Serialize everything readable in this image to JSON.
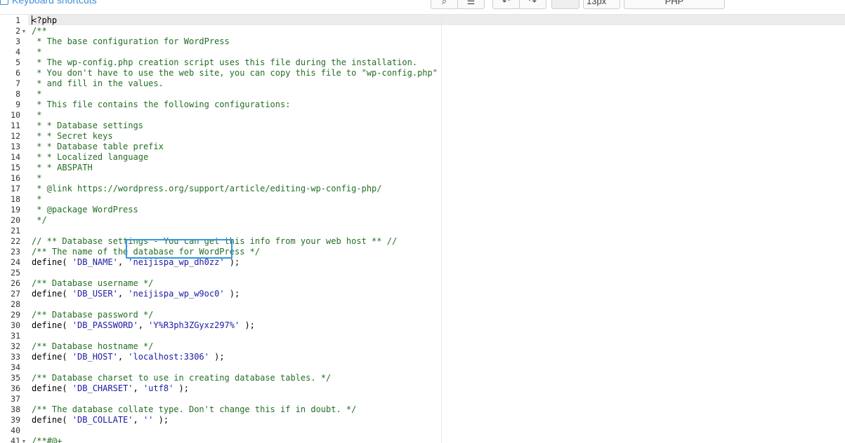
{
  "toolbar": {
    "keyboard_shortcuts_label": "Keyboard shortcuts",
    "font_size_value": "13px",
    "mode_value": "PHP"
  },
  "editor": {
    "lines": [
      {
        "n": "1",
        "fold": "",
        "tokens": [
          {
            "c": "tag",
            "t": "<?php"
          }
        ]
      },
      {
        "n": "2",
        "fold": "▾",
        "tokens": [
          {
            "c": "comment",
            "t": "/**"
          }
        ]
      },
      {
        "n": "3",
        "fold": "",
        "tokens": [
          {
            "c": "comment",
            "t": " * The base configuration for WordPress"
          }
        ]
      },
      {
        "n": "4",
        "fold": "",
        "tokens": [
          {
            "c": "comment",
            "t": " *"
          }
        ]
      },
      {
        "n": "5",
        "fold": "",
        "tokens": [
          {
            "c": "comment",
            "t": " * The wp-config.php creation script uses this file during the installation."
          }
        ]
      },
      {
        "n": "6",
        "fold": "",
        "tokens": [
          {
            "c": "comment",
            "t": " * You don't have to use the web site, you can copy this file to \"wp-config.php\""
          }
        ]
      },
      {
        "n": "7",
        "fold": "",
        "tokens": [
          {
            "c": "comment",
            "t": " * and fill in the values."
          }
        ]
      },
      {
        "n": "8",
        "fold": "",
        "tokens": [
          {
            "c": "comment",
            "t": " *"
          }
        ]
      },
      {
        "n": "9",
        "fold": "",
        "tokens": [
          {
            "c": "comment",
            "t": " * This file contains the following configurations:"
          }
        ]
      },
      {
        "n": "10",
        "fold": "",
        "tokens": [
          {
            "c": "comment",
            "t": " *"
          }
        ]
      },
      {
        "n": "11",
        "fold": "",
        "tokens": [
          {
            "c": "comment",
            "t": " * * Database settings"
          }
        ]
      },
      {
        "n": "12",
        "fold": "",
        "tokens": [
          {
            "c": "comment",
            "t": " * * Secret keys"
          }
        ]
      },
      {
        "n": "13",
        "fold": "",
        "tokens": [
          {
            "c": "comment",
            "t": " * * Database table prefix"
          }
        ]
      },
      {
        "n": "14",
        "fold": "",
        "tokens": [
          {
            "c": "comment",
            "t": " * * Localized language"
          }
        ]
      },
      {
        "n": "15",
        "fold": "",
        "tokens": [
          {
            "c": "comment",
            "t": " * * ABSPATH"
          }
        ]
      },
      {
        "n": "16",
        "fold": "",
        "tokens": [
          {
            "c": "comment",
            "t": " *"
          }
        ]
      },
      {
        "n": "17",
        "fold": "",
        "tokens": [
          {
            "c": "comment",
            "t": " * @link https://wordpress.org/support/article/editing-wp-config-php/"
          }
        ]
      },
      {
        "n": "18",
        "fold": "",
        "tokens": [
          {
            "c": "comment",
            "t": " *"
          }
        ]
      },
      {
        "n": "19",
        "fold": "",
        "tokens": [
          {
            "c": "comment",
            "t": " * @package WordPress"
          }
        ]
      },
      {
        "n": "20",
        "fold": "",
        "tokens": [
          {
            "c": "comment",
            "t": " */"
          }
        ]
      },
      {
        "n": "21",
        "fold": "",
        "tokens": []
      },
      {
        "n": "22",
        "fold": "",
        "tokens": [
          {
            "c": "comment",
            "t": "// ** Database settings - You can get this info from your web host ** //"
          }
        ]
      },
      {
        "n": "23",
        "fold": "",
        "tokens": [
          {
            "c": "comment",
            "t": "/** The name of the database for WordPress */"
          }
        ]
      },
      {
        "n": "24",
        "fold": "",
        "tokens": [
          {
            "c": "plain",
            "t": "define( "
          },
          {
            "c": "string",
            "t": "'DB_NAME'"
          },
          {
            "c": "plain",
            "t": ", "
          },
          {
            "c": "string",
            "t": "'neijispa_wp_dh0zz'"
          },
          {
            "c": "plain",
            "t": " );"
          }
        ]
      },
      {
        "n": "25",
        "fold": "",
        "tokens": []
      },
      {
        "n": "26",
        "fold": "",
        "tokens": [
          {
            "c": "comment",
            "t": "/** Database username */"
          }
        ]
      },
      {
        "n": "27",
        "fold": "",
        "tokens": [
          {
            "c": "plain",
            "t": "define( "
          },
          {
            "c": "string",
            "t": "'DB_USER'"
          },
          {
            "c": "plain",
            "t": ", "
          },
          {
            "c": "string",
            "t": "'neijispa_wp_w9oc0'"
          },
          {
            "c": "plain",
            "t": " );"
          }
        ]
      },
      {
        "n": "28",
        "fold": "",
        "tokens": []
      },
      {
        "n": "29",
        "fold": "",
        "tokens": [
          {
            "c": "comment",
            "t": "/** Database password */"
          }
        ]
      },
      {
        "n": "30",
        "fold": "",
        "tokens": [
          {
            "c": "plain",
            "t": "define( "
          },
          {
            "c": "string",
            "t": "'DB_PASSWORD'"
          },
          {
            "c": "plain",
            "t": ", "
          },
          {
            "c": "string",
            "t": "'Y%R3ph3ZGyxz297%'"
          },
          {
            "c": "plain",
            "t": " );"
          }
        ]
      },
      {
        "n": "31",
        "fold": "",
        "tokens": []
      },
      {
        "n": "32",
        "fold": "",
        "tokens": [
          {
            "c": "comment",
            "t": "/** Database hostname */"
          }
        ]
      },
      {
        "n": "33",
        "fold": "",
        "tokens": [
          {
            "c": "plain",
            "t": "define( "
          },
          {
            "c": "string",
            "t": "'DB_HOST'"
          },
          {
            "c": "plain",
            "t": ", "
          },
          {
            "c": "string",
            "t": "'localhost:3306'"
          },
          {
            "c": "plain",
            "t": " );"
          }
        ]
      },
      {
        "n": "34",
        "fold": "",
        "tokens": []
      },
      {
        "n": "35",
        "fold": "",
        "tokens": [
          {
            "c": "comment",
            "t": "/** Database charset to use in creating database tables. */"
          }
        ]
      },
      {
        "n": "36",
        "fold": "",
        "tokens": [
          {
            "c": "plain",
            "t": "define( "
          },
          {
            "c": "string",
            "t": "'DB_CHARSET'"
          },
          {
            "c": "plain",
            "t": ", "
          },
          {
            "c": "string",
            "t": "'utf8'"
          },
          {
            "c": "plain",
            "t": " );"
          }
        ]
      },
      {
        "n": "37",
        "fold": "",
        "tokens": []
      },
      {
        "n": "38",
        "fold": "",
        "tokens": [
          {
            "c": "comment",
            "t": "/** The database collate type. Don't change this if in doubt. */"
          }
        ]
      },
      {
        "n": "39",
        "fold": "",
        "tokens": [
          {
            "c": "plain",
            "t": "define( "
          },
          {
            "c": "string",
            "t": "'DB_COLLATE'"
          },
          {
            "c": "plain",
            "t": ", "
          },
          {
            "c": "string",
            "t": "''"
          },
          {
            "c": "plain",
            "t": " );"
          }
        ]
      },
      {
        "n": "40",
        "fold": "",
        "tokens": []
      },
      {
        "n": "41",
        "fold": "▾",
        "tokens": [
          {
            "c": "comment",
            "t": "/**#@+"
          }
        ]
      }
    ]
  }
}
